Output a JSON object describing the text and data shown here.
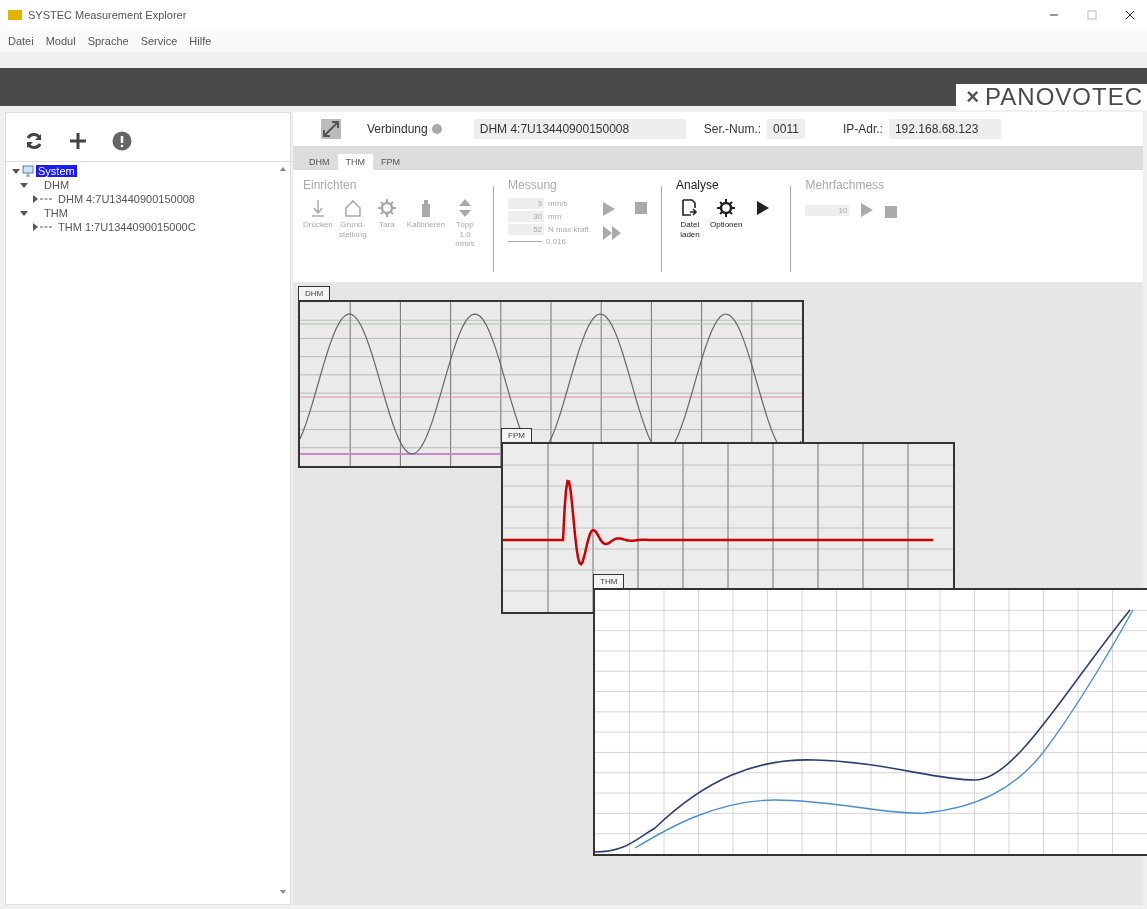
{
  "window": {
    "title": "SYSTEC Measurement Explorer"
  },
  "menu": [
    "Datei",
    "Modul",
    "Sprache",
    "Service",
    "Hilfe"
  ],
  "brand": {
    "mark": "×",
    "name": "PANOVOTEC"
  },
  "tree": [
    {
      "label": "System",
      "selected": true,
      "expanded": true,
      "children": [
        {
          "label": "DHM",
          "selected": false,
          "expanded": true,
          "children": [
            {
              "label": "DHM 4:7U13440900150008",
              "selected": false
            }
          ]
        },
        {
          "label": "THM",
          "selected": false,
          "expanded": true,
          "children": [
            {
              "label": "THM 1:7U1344090015000C",
              "selected": false
            }
          ]
        }
      ]
    }
  ],
  "connection": {
    "label": "Verbindung",
    "device": "DHM 4:7U13440900150008",
    "serial_label": "Ser.-Num.:",
    "serial": "0011",
    "ip_label": "IP-Adr.:",
    "ip": "192.168.68.123"
  },
  "tabs": [
    {
      "label": "DHM",
      "selected": false
    },
    {
      "label": "THM",
      "selected": true
    },
    {
      "label": "FPM",
      "selected": false
    }
  ],
  "ribbon": {
    "einrichten": {
      "title": "Einrichten",
      "disabled": true,
      "items": [
        {
          "kind": "press",
          "label": "Drücken"
        },
        {
          "kind": "home",
          "label": "Grund-\nstellung"
        },
        {
          "kind": "gear",
          "label": "Tara"
        },
        {
          "kind": "weight",
          "label": "Kalibrieren"
        },
        {
          "kind": "updown",
          "label": "Topp\n1.0\nmm/s"
        }
      ]
    },
    "messung": {
      "title": "Messung",
      "disabled": true,
      "fields": [
        {
          "value": "3",
          "unit": "mm/s"
        },
        {
          "value": "30",
          "unit": "mm"
        },
        {
          "value": "52",
          "unit": "N max kraft"
        }
      ],
      "readout": "0.016"
    },
    "analyse": {
      "title": "Analyse",
      "disabled": false,
      "items": [
        {
          "kind": "file",
          "label": "Datei\nladen"
        },
        {
          "kind": "gear",
          "label": "Optionen"
        },
        {
          "kind": "play"
        }
      ]
    },
    "mehrfach": {
      "title": "Mehrfachmess",
      "disabled": true,
      "value": "10"
    }
  },
  "charts": [
    {
      "kind": "sine",
      "tab": "DHM"
    },
    {
      "kind": "impulse",
      "tab": "FPM"
    },
    {
      "kind": "hysteresis",
      "tab": "THM"
    }
  ]
}
